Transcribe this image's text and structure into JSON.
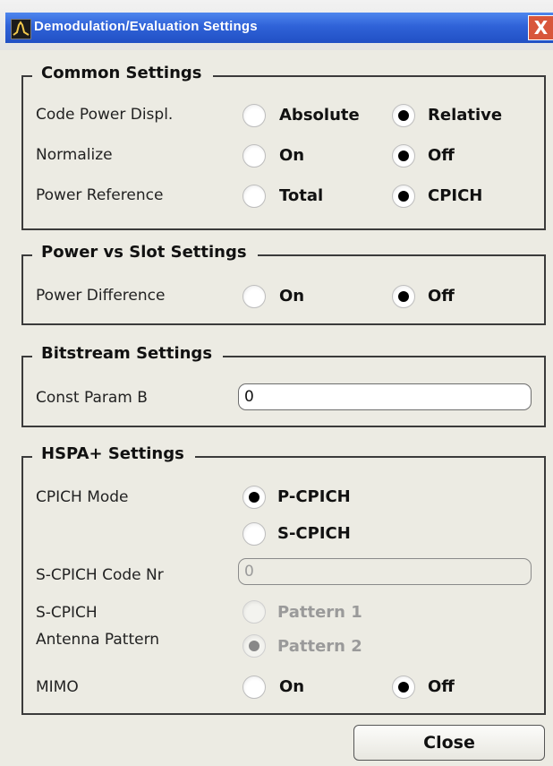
{
  "window": {
    "title": "Demodulation/Evaluation Settings",
    "close_glyph": "X",
    "icon": "analyzer-icon"
  },
  "common": {
    "title": "Common Settings",
    "code_power": {
      "label": "Code Power Displ.",
      "opt1": "Absolute",
      "opt2": "Relative",
      "selected": "Relative"
    },
    "normalize": {
      "label": "Normalize",
      "opt1": "On",
      "opt2": "Off",
      "selected": "Off"
    },
    "power_ref": {
      "label": "Power Reference",
      "opt1": "Total",
      "opt2": "CPICH",
      "selected": "CPICH"
    }
  },
  "pvs": {
    "title": "Power vs Slot Settings",
    "power_diff": {
      "label": "Power Difference",
      "opt1": "On",
      "opt2": "Off",
      "selected": "Off"
    }
  },
  "bitstream": {
    "title": "Bitstream Settings",
    "const_param": {
      "label": "Const Param B",
      "value": "0"
    }
  },
  "hspa": {
    "title": "HSPA+ Settings",
    "cpich_mode": {
      "label": "CPICH Mode",
      "opt1": "P-CPICH",
      "opt2": "S-CPICH",
      "selected": "P-CPICH"
    },
    "scpich_code": {
      "label": "S-CPICH Code Nr",
      "value": "0"
    },
    "antenna": {
      "label1": "S-CPICH",
      "label2": "Antenna Pattern",
      "opt1": "Pattern 1",
      "opt2": "Pattern 2",
      "selected": "Pattern 2"
    },
    "mimo": {
      "label": "MIMO",
      "opt1": "On",
      "opt2": "Off",
      "selected": "Off"
    }
  },
  "footer": {
    "close_label": "Close"
  }
}
